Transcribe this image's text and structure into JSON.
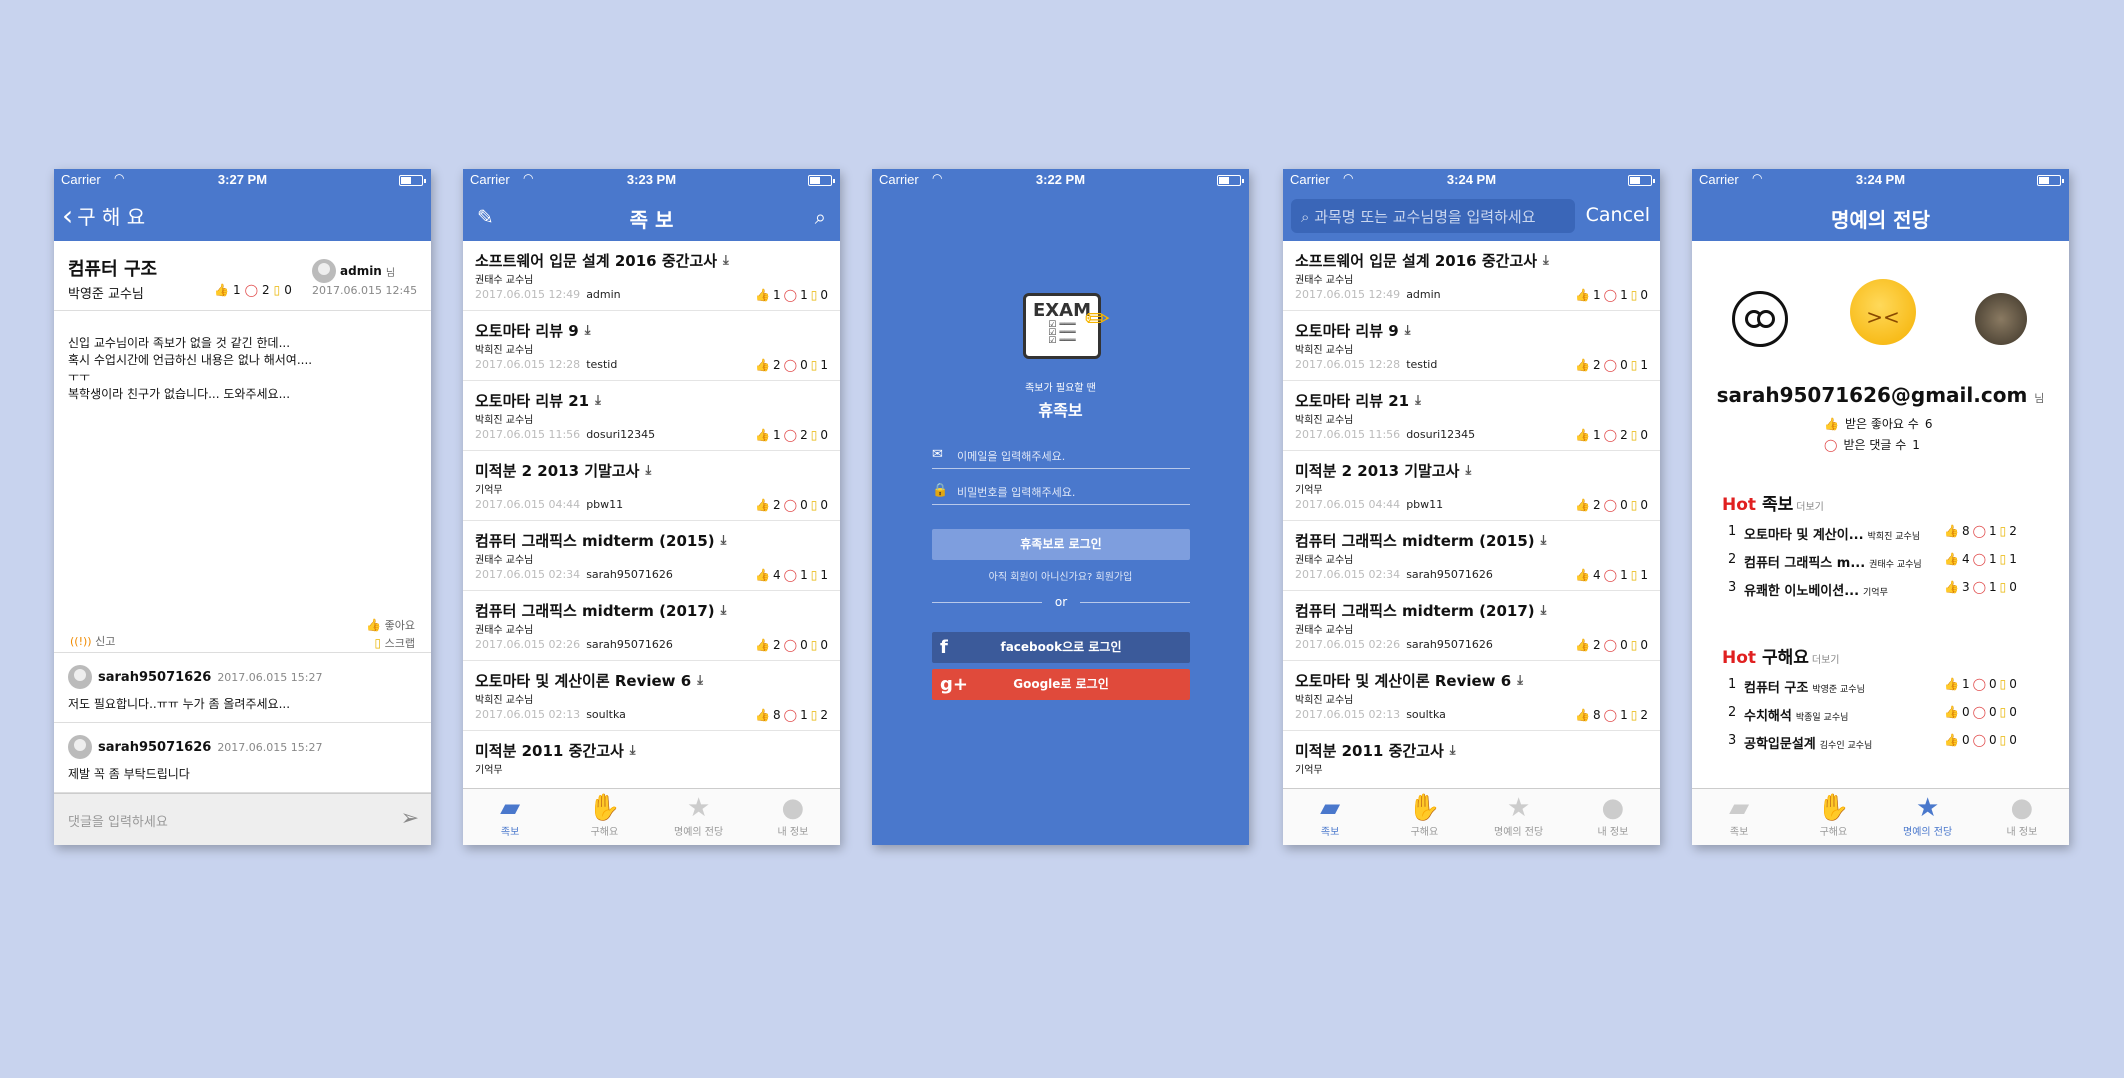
{
  "status": {
    "carrier": "Carrier"
  },
  "p1": {
    "time": "3:27 PM",
    "back_label": "구 해 요",
    "title": "컴퓨터 구조",
    "professor": "박영준 교수님",
    "likes": "1",
    "comments": "2",
    "scraps": "0",
    "author": "admin",
    "author_suffix": "님",
    "date": "2017.06.015 12:45",
    "body": "신입 교수님이라 족보가 없을 것 같긴 한데...\n혹시 수업시간에 언급하신 내용은 없나 해서여....\nㅜㅜ\n복학생이라 친구가 없습니다... 도와주세요...",
    "report_label": "신고",
    "like_label": "좋아요",
    "scrap_label": "스크랩",
    "comments_list": [
      {
        "user": "sarah95071626",
        "date": "2017.06.015 15:27",
        "text": "저도 필요합니다..ㅠㅠ 누가 좀 올려주세요..."
      },
      {
        "user": "sarah95071626",
        "date": "2017.06.015 15:27",
        "text": "제발 꼭 좀 부탁드립니다"
      }
    ],
    "comment_placeholder": "댓글을 입력하세요"
  },
  "p2": {
    "time": "3:23 PM",
    "title": "족 보"
  },
  "p3": {
    "time": "3:22 PM",
    "logo_text": "EXAM",
    "subtitle": "족보가 필요할 땐",
    "app_name": "휴족보",
    "email_placeholder": "이메일을 입력해주세요.",
    "password_placeholder": "비밀번호를 입력해주세요.",
    "login_button": "휴족보로 로그인",
    "signup_text": "아직 회원이 아니신가요? 회원가입",
    "or_text": "or",
    "facebook_button": "facebook으로 로그인",
    "google_button": "Google로 로그인"
  },
  "p4": {
    "time": "3:24 PM",
    "search_placeholder": "과목명 또는 교수님명을 입력하세요",
    "cancel": "Cancel"
  },
  "posts": [
    {
      "title": "소프트웨어 입문 설계 2016 중간고사",
      "professor": "권태수 교수님",
      "date": "2017.06.015 12:49",
      "user": "admin",
      "likes": "1",
      "comments": "1",
      "scraps": "0"
    },
    {
      "title": "오토마타 리뷰 9",
      "professor": "박희진 교수님",
      "date": "2017.06.015 12:28",
      "user": "testid",
      "likes": "2",
      "comments": "0",
      "scraps": "1"
    },
    {
      "title": "오토마타 리뷰 21",
      "professor": "박희진 교수님",
      "date": "2017.06.015 11:56",
      "user": "dosuri12345",
      "likes": "1",
      "comments": "2",
      "scraps": "0"
    },
    {
      "title": "미적분 2 2013 기말고사",
      "professor": "기억무",
      "date": "2017.06.015 04:44",
      "user": "pbw11",
      "likes": "2",
      "comments": "0",
      "scraps": "0"
    },
    {
      "title": "컴퓨터 그래픽스 midterm (2015)",
      "professor": "권태수 교수님",
      "date": "2017.06.015 02:34",
      "user": "sarah95071626",
      "likes": "4",
      "comments": "1",
      "scraps": "1"
    },
    {
      "title": "컴퓨터 그래픽스 midterm (2017)",
      "professor": "권태수 교수님",
      "date": "2017.06.015 02:26",
      "user": "sarah95071626",
      "likes": "2",
      "comments": "0",
      "scraps": "0"
    },
    {
      "title": "오토마타 및 계산이론 Review 6",
      "professor": "박희진 교수님",
      "date": "2017.06.015 02:13",
      "user": "soultka",
      "likes": "8",
      "comments": "1",
      "scraps": "2"
    },
    {
      "title": "미적분 2011 중간고사",
      "professor": "기억무",
      "date": "",
      "user": "",
      "likes": "",
      "comments": "",
      "scraps": ""
    }
  ],
  "tabs": [
    "족보",
    "구해요",
    "명예의 전당",
    "내 정보"
  ],
  "p5": {
    "time": "3:24 PM",
    "title": "명예의 전당",
    "email": "sarah95071626@gmail.com",
    "email_suffix": "님",
    "likes_label": "받은 좋아요 수",
    "likes_value": "6",
    "comments_label": "받은 댓글 수",
    "comments_value": "1",
    "hot_word": "Hot",
    "sec1_title": "족보",
    "sec2_title": "구해요",
    "more": "더보기",
    "sec1_items": [
      {
        "n": "1",
        "title": "오토마타 및 계산이...",
        "prof": "박희진 교수님",
        "likes": "8",
        "comments": "1",
        "scraps": "2"
      },
      {
        "n": "2",
        "title": "컴퓨터 그래픽스 m...",
        "prof": "권태수 교수님",
        "likes": "4",
        "comments": "1",
        "scraps": "1"
      },
      {
        "n": "3",
        "title": "유쾌한 이노베이션...",
        "prof": "기억무",
        "likes": "3",
        "comments": "1",
        "scraps": "0"
      }
    ],
    "sec2_items": [
      {
        "n": "1",
        "title": "컴퓨터 구조",
        "prof": "박영준 교수님",
        "likes": "1",
        "comments": "0",
        "scraps": "0"
      },
      {
        "n": "2",
        "title": "수치해석",
        "prof": "박종일 교수님",
        "likes": "0",
        "comments": "0",
        "scraps": "0"
      },
      {
        "n": "3",
        "title": "공학입문설계",
        "prof": "김수인 교수님",
        "likes": "0",
        "comments": "0",
        "scraps": "0"
      }
    ]
  }
}
